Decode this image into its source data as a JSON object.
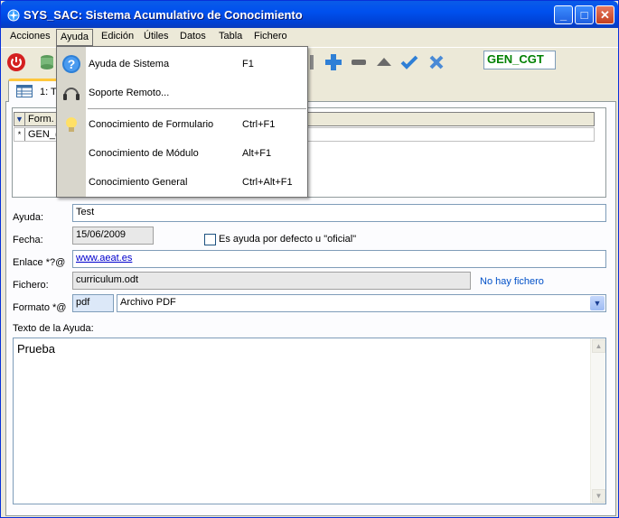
{
  "window": {
    "title": "SYS_SAC: Sistema Acumulativo de Conocimiento",
    "btn_min": "_",
    "btn_max": "□",
    "btn_close": "✕"
  },
  "menubar": {
    "items": [
      "Acciones",
      "Ayuda",
      "Edición",
      "Útiles",
      "Datos",
      "Tabla",
      "Fichero"
    ],
    "active": "Ayuda"
  },
  "toolbar": {
    "code_value": "GEN_CGT"
  },
  "tab": {
    "label": "1: T"
  },
  "grid": {
    "header_mark": "▼",
    "header_col": "Form.",
    "row_mark": "*",
    "row_value": "GEN_("
  },
  "form": {
    "ayuda_label": "Ayuda:",
    "ayuda_value": "Test",
    "fecha_label": "Fecha:",
    "fecha_value": "15/06/2009",
    "default_label": "Es ayuda por defecto u \"oficial\"",
    "enlace_label": "Enlace *?@",
    "enlace_value": "www.aeat.es",
    "fichero_label": "Fichero:",
    "fichero_value": "curriculum.odt",
    "no_file": "No hay fichero",
    "formato_label": "Formato *@",
    "formato_code": "pdf",
    "formato_name": "Archivo PDF",
    "texto_label": "Texto de la Ayuda:",
    "texto_value": "Prueba"
  },
  "dropdown": {
    "items": [
      {
        "label": "Ayuda de Sistema",
        "shortcut": "F1",
        "icon": "help-icon"
      },
      {
        "label": "Soporte Remoto...",
        "shortcut": "",
        "icon": "headset-icon"
      },
      {
        "label": "Conocimiento de Formulario",
        "shortcut": "Ctrl+F1",
        "icon": "lightbulb-icon"
      },
      {
        "label": "Conocimiento de Módulo",
        "shortcut": "Alt+F1",
        "icon": ""
      },
      {
        "label": "Conocimiento General",
        "shortcut": "Ctrl+Alt+F1",
        "icon": ""
      }
    ]
  },
  "colors": {
    "titlebar": "#0050ee",
    "code_text": "#008000",
    "link": "#0000cc",
    "accent_tab": "#ffc73c"
  }
}
